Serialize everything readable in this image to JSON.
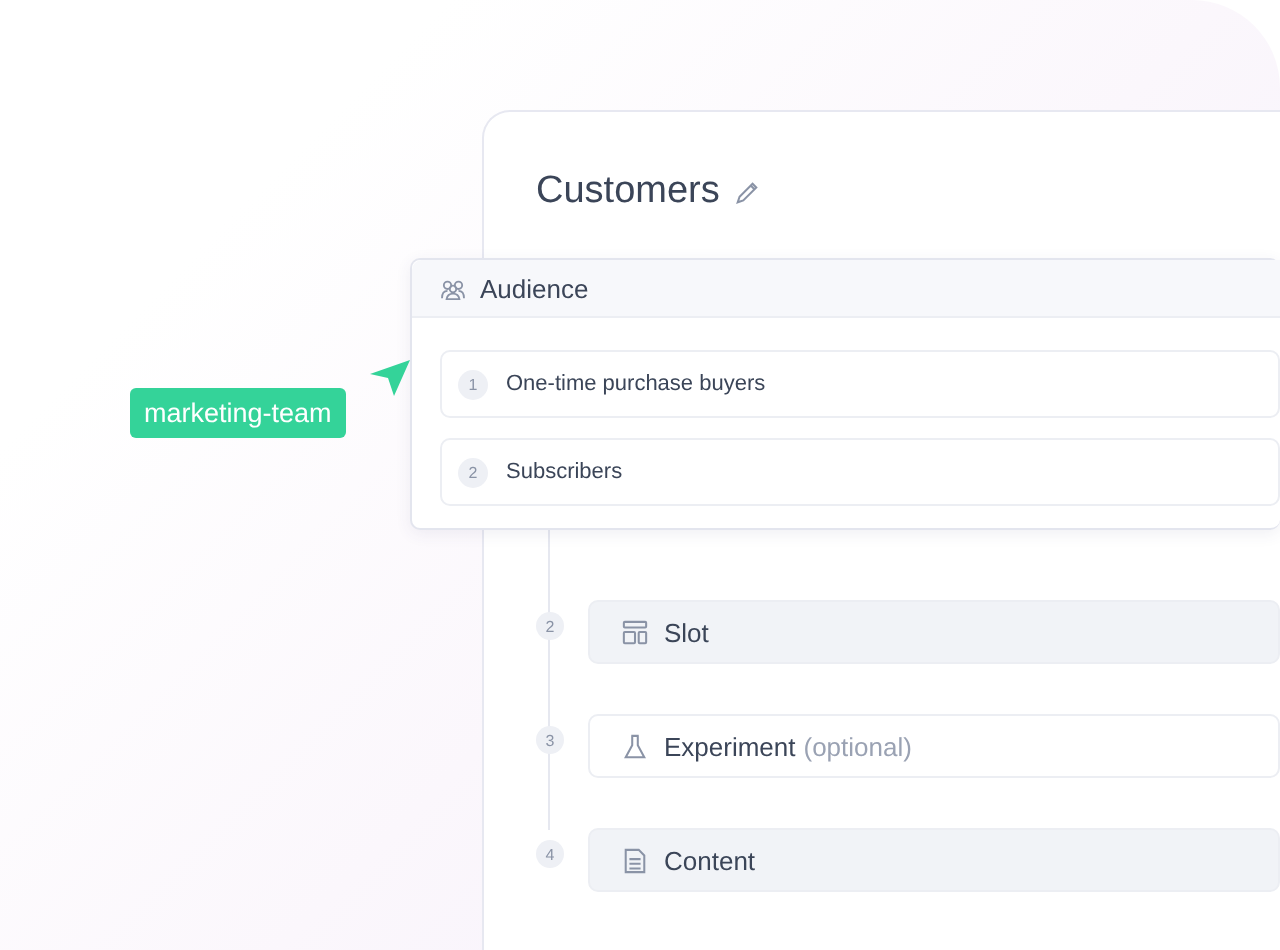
{
  "page": {
    "title": "Customers"
  },
  "audience": {
    "title": "Audience",
    "items": [
      {
        "number": "1",
        "label": "One-time purchase buyers"
      },
      {
        "number": "2",
        "label": "Subscribers"
      }
    ]
  },
  "tag": {
    "label": "marketing-team",
    "color": "#34d399"
  },
  "steps": [
    {
      "number": "2",
      "kind": "slot",
      "label": "Slot",
      "filled": true
    },
    {
      "number": "3",
      "kind": "experiment",
      "label": "Experiment",
      "note": "(optional)",
      "filled": false
    },
    {
      "number": "4",
      "kind": "content",
      "label": "Content",
      "filled": true
    }
  ]
}
